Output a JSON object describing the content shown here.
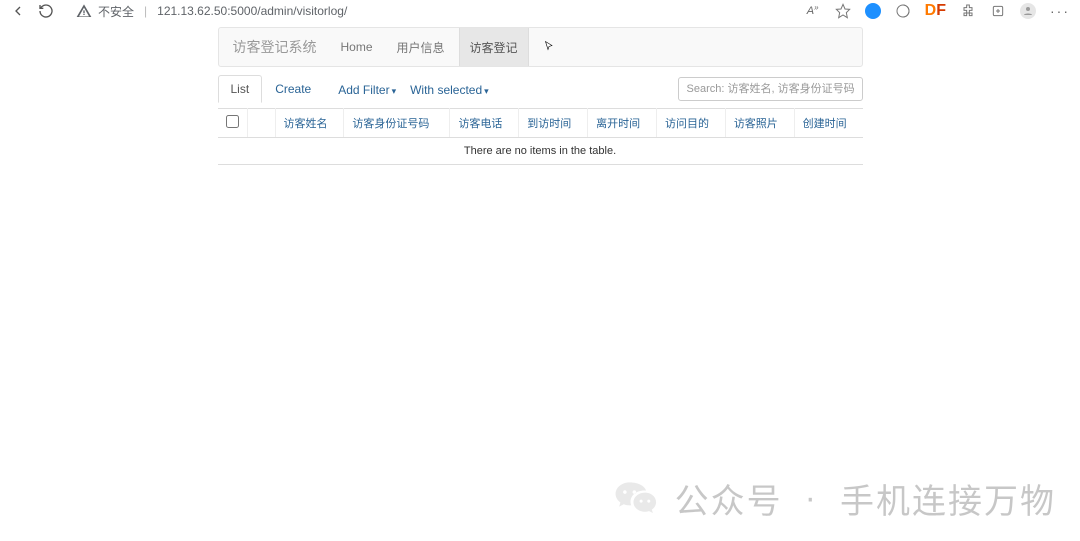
{
  "browser": {
    "insecure_label": "不安全",
    "url": "121.13.62.50:5000/admin/visitorlog/"
  },
  "navbar": {
    "brand": "访客登记系统",
    "items": [
      {
        "label": "Home",
        "active": false
      },
      {
        "label": "用户信息",
        "active": false
      },
      {
        "label": "访客登记",
        "active": true
      }
    ]
  },
  "toolbar": {
    "tabs": {
      "list": "List",
      "create": "Create"
    },
    "add_filter": "Add Filter",
    "with_selected": "With selected",
    "search_placeholder": "Search: 访客姓名, 访客身份证号码, 访客电话..."
  },
  "table": {
    "headers": [
      "访客姓名",
      "访客身份证号码",
      "访客电话",
      "到访时间",
      "离开时间",
      "访问目的",
      "访客照片",
      "创建时间"
    ],
    "empty": "There are no items in the table."
  },
  "watermark": {
    "text_prefix": "公众号",
    "dot": "·",
    "text_suffix": "手机连接万物"
  }
}
